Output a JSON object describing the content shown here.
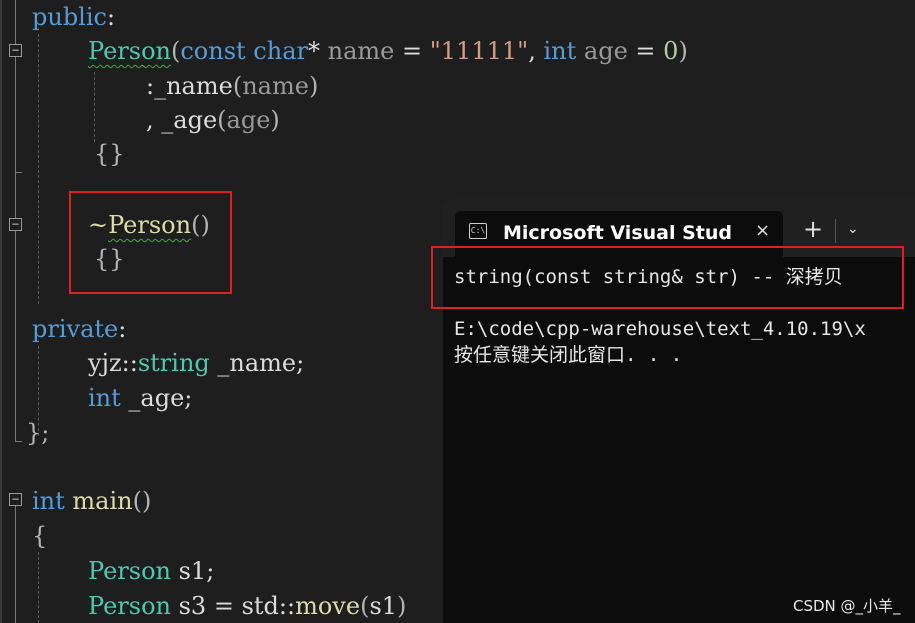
{
  "editor": {
    "line_public": {
      "kw": "public",
      "colon": ":"
    },
    "line_ctor": {
      "name": "Person",
      "open": "(",
      "kw_const": "const",
      "kw_char": "char",
      "star": "*",
      "p_name": "name",
      "eq1": "=",
      "default_str": "\"11111\"",
      "comma": ",",
      "kw_int": "int",
      "p_age": "age",
      "eq2": "=",
      "default_num": "0",
      "close": ")"
    },
    "line_init1": {
      "prefix": ":",
      "member": "_name",
      "open": "(",
      "arg": "name",
      "close": ")"
    },
    "line_init2": {
      "prefix": ",",
      "member": "_age",
      "open": "(",
      "arg": "age",
      "close": ")"
    },
    "line_ctor_body": "{}",
    "line_dtor": {
      "tilde": "~",
      "name": "Person",
      "parens": "()"
    },
    "line_dtor_body": "{}",
    "line_private": {
      "kw": "private",
      "colon": ":"
    },
    "line_member1": {
      "ns": "yjz",
      "sep": "::",
      "type": "string",
      "name": "_name",
      "semi": ";"
    },
    "line_member2": {
      "kw": "int",
      "name": "_age",
      "semi": ";"
    },
    "line_class_end": "};",
    "line_main": {
      "kw": "int",
      "name": "main",
      "parens": "()"
    },
    "line_main_open": "{",
    "line_s1": {
      "type": "Person",
      "name": "s1",
      "semi": ";"
    },
    "line_s3": {
      "type": "Person",
      "name": "s3",
      "eq": "=",
      "ns": "std",
      "sep": "::",
      "fn": "move",
      "open": "(",
      "arg": "s1",
      "close": ")"
    },
    "fold_marker": "−"
  },
  "terminal": {
    "tab_icon": "C:\\",
    "tab_title": "Microsoft Visual Studio",
    "close_symbol": "×",
    "new_tab_symbol": "+",
    "dropdown_symbol": "⌄",
    "output_lines": [
      "string(const string& str) -- 深拷贝",
      "",
      "E:\\code\\cpp-warehouse\\text_4.10.19\\x",
      "按任意键关闭此窗口. . ."
    ]
  },
  "watermark": "CSDN @_小羊_",
  "colors": {
    "editor_bg": "#1e1e1e",
    "keyword": "#569cd6",
    "type": "#4ec9b0",
    "function": "#dcdcaa",
    "string": "#d69d85",
    "number": "#b5cea8",
    "parameter": "#9a9a9a",
    "highlight_box": "#e02020",
    "terminal_bg": "#0c0c0c"
  },
  "icons": {
    "fold": "collapse-icon",
    "tab": "command-prompt-icon",
    "close": "close-icon",
    "new_tab": "plus-icon",
    "dropdown": "chevron-down-icon"
  }
}
